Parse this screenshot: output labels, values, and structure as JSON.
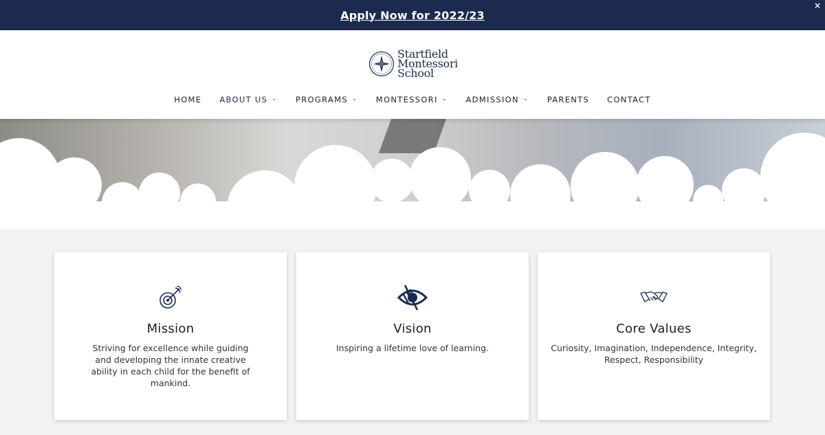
{
  "banner": {
    "link": "Apply Now for 2022/23",
    "close": "×"
  },
  "logo": {
    "line1": "Startfield",
    "line2": "Montessori",
    "line3": "School",
    "icon": "compass-star-icon"
  },
  "nav": [
    {
      "label": "HOME",
      "has_dropdown": false
    },
    {
      "label": "ABOUT US",
      "has_dropdown": true
    },
    {
      "label": "PROGRAMS",
      "has_dropdown": true
    },
    {
      "label": "MONTESSORI",
      "has_dropdown": true
    },
    {
      "label": "ADMISSION",
      "has_dropdown": true
    },
    {
      "label": "PARENTS",
      "has_dropdown": false
    },
    {
      "label": "CONTACT",
      "has_dropdown": false
    }
  ],
  "nav_chevron": "⌄",
  "cards": [
    {
      "icon": "target-arrow-icon",
      "title": "Mission",
      "text": "Striving for excellence while guiding and developing the innate creative ability in each child for the benefit of mankind."
    },
    {
      "icon": "eye-icon",
      "title": "Vision",
      "text": "Inspiring a lifetime love of learning."
    },
    {
      "icon": "handshake-icon",
      "title": "Core Values",
      "text": "Curiosity, Imagination, Independence, Integrity, Respect, Responsibility"
    }
  ],
  "colors": {
    "navy": "#1b2a4e",
    "background": "#f2f2f2",
    "card": "#ffffff"
  }
}
